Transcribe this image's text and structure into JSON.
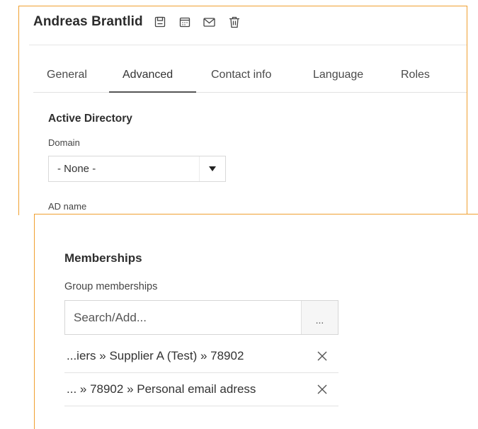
{
  "header": {
    "title": "Andreas Brantlid",
    "actions": [
      {
        "icon": "save-icon"
      },
      {
        "icon": "calendar-icon"
      },
      {
        "icon": "email-icon"
      },
      {
        "icon": "trash-icon"
      }
    ]
  },
  "tabs": [
    {
      "label": "General",
      "active": false
    },
    {
      "label": "Advanced",
      "active": true
    },
    {
      "label": "Contact info",
      "active": false
    },
    {
      "label": "Language",
      "active": false
    },
    {
      "label": "Roles",
      "active": false
    }
  ],
  "active_directory": {
    "heading": "Active Directory",
    "domain_label": "Domain",
    "domain_value": "- None -",
    "ad_name_label": "AD name"
  },
  "memberships": {
    "heading": "Memberships",
    "group_label": "Group memberships",
    "search_placeholder": "Search/Add...",
    "more_label": "...",
    "items": [
      {
        "label": "...iers » Supplier A (Test) » 78902"
      },
      {
        "label": "... » 78902 » Personal email adress"
      }
    ]
  },
  "colors": {
    "highlight_border": "#f0a030",
    "active_tab_underline": "#555555"
  }
}
